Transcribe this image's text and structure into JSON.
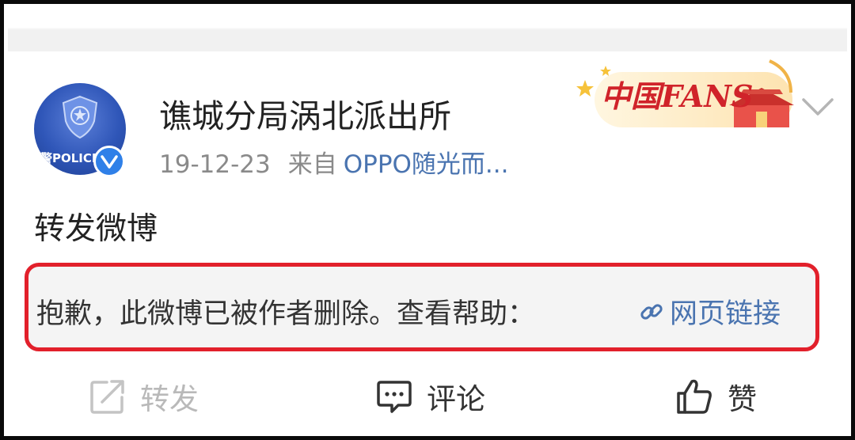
{
  "post": {
    "author": {
      "name": "谯城分局涡北派出所",
      "avatar_text": "警POLICE",
      "avatar_icon": "police-emblem-icon",
      "verified_icon": "verified-v-icon"
    },
    "meta": {
      "date": "19-12-23",
      "from_label": "来自",
      "source": "OPPO随光而..."
    },
    "badge": {
      "text": "中国FANS",
      "icon": "china-fans-badge"
    },
    "menu_icon": "chevron-down-icon",
    "content": "转发微博",
    "deleted_notice": {
      "message": "抱歉，此微博已被作者删除。查看帮助：",
      "link_label": "网页链接",
      "link_icon": "link-icon",
      "highlight_color": "#e2202b"
    }
  },
  "actions": {
    "repost": {
      "label": "转发",
      "icon": "repost-icon",
      "color": "#b9b9b9"
    },
    "comment": {
      "label": "评论",
      "icon": "comment-icon"
    },
    "like": {
      "label": "赞",
      "icon": "thumbs-up-icon"
    }
  },
  "colors": {
    "link_blue": "#4a74b0",
    "verified_blue": "#2f80e8",
    "notice_bg": "#f4f4f4"
  }
}
